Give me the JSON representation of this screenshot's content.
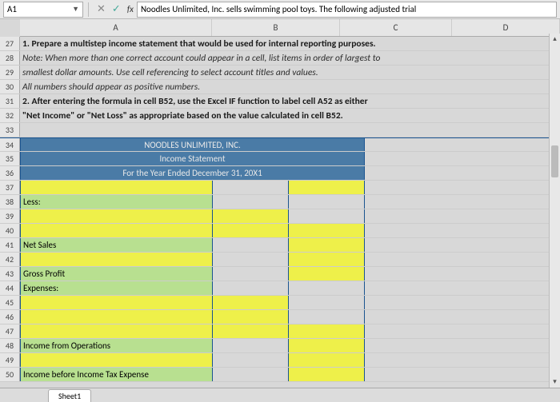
{
  "nameBox": "A1",
  "fxCancel": "✕",
  "fxAccept": "✓",
  "fxLabel": "fx",
  "formula": "Noodles Unlimited, Inc. sells swimming pool toys.  The following adjusted trial",
  "cols": {
    "A": "A",
    "B": "B",
    "C": "C",
    "D": "D"
  },
  "rows": {
    "r27": "1. Prepare a multistep income statement that would be used for internal reporting purposes.",
    "r28": "Note:  When more than one correct account could appear in a cell, list items in order of largest to",
    "r29": "smallest dollar amounts.  Use cell referencing to select account titles and values.",
    "r30": "All numbers should appear as positive numbers.",
    "r31": "2. After entering the formula in cell B52, use the Excel IF function to label cell A52 as either",
    "r32": "\"Net Income\" or \"Net Loss\" as appropriate based on the value calculated in cell B52.",
    "r34": "NOODLES UNLIMITED, INC.",
    "r35": "Income Statement",
    "r36": "For the Year Ended December 31, 20X1",
    "r38": "Less:",
    "r41": "Net Sales",
    "r43": "Gross Profit",
    "r44": "Expenses:",
    "r48": "Income from Operations",
    "r50": "Income before Income Tax Expense"
  },
  "rowNums": [
    "27",
    "28",
    "29",
    "30",
    "31",
    "32",
    "33",
    "34",
    "35",
    "36",
    "37",
    "38",
    "39",
    "40",
    "41",
    "42",
    "43",
    "44",
    "45",
    "46",
    "47",
    "48",
    "49",
    "50"
  ],
  "sheetTab": "Sheet1"
}
